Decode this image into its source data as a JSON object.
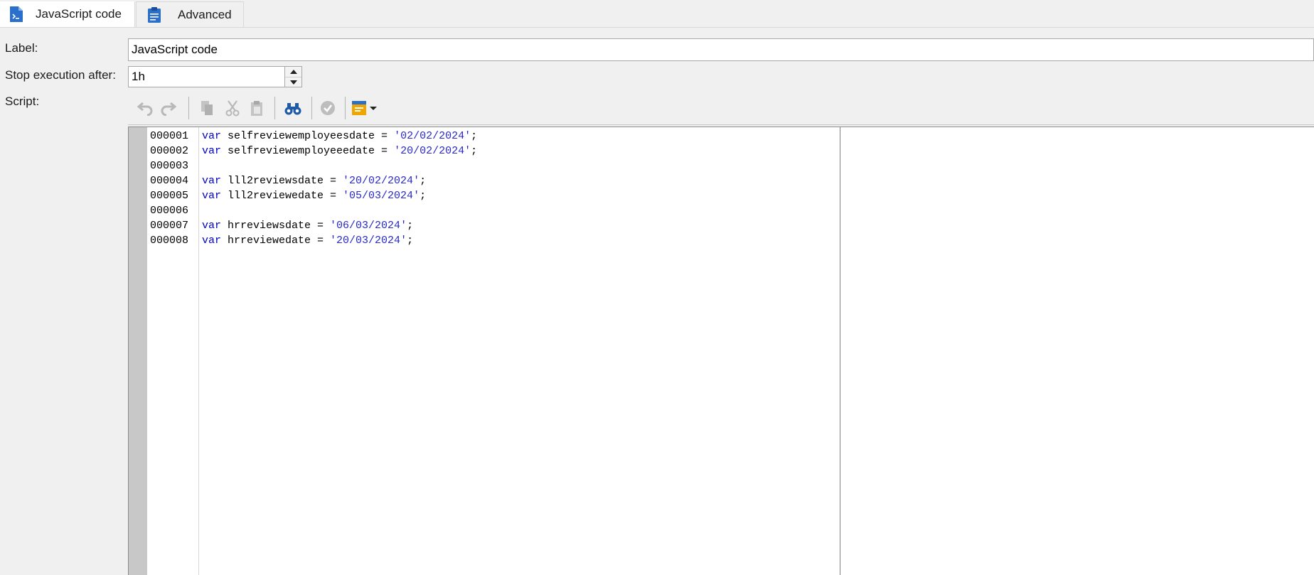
{
  "tabs": [
    {
      "label": "JavaScript code",
      "icon": "script-file-icon",
      "active": true
    },
    {
      "label": "Advanced",
      "icon": "clipboard-icon",
      "active": false
    }
  ],
  "form": {
    "label_caption": "Label:",
    "label_value": "JavaScript code",
    "stop_caption": "Stop execution after:",
    "stop_value": "1h",
    "script_caption": "Script:"
  },
  "toolbar": {
    "buttons": [
      "undo-icon",
      "redo-icon",
      "copy-icon",
      "cut-icon",
      "paste-icon",
      "find-binoculars-icon",
      "check-syntax-icon",
      "insert-field-dropdown-icon"
    ]
  },
  "editor": {
    "lines": [
      {
        "num": "000001",
        "kw": "var",
        "rest": " selfreviewemployeesdate = ",
        "str": "'02/02/2024'",
        "end": ";"
      },
      {
        "num": "000002",
        "kw": "var",
        "rest": " selfreviewemployeeedate = ",
        "str": "'20/02/2024'",
        "end": ";"
      },
      {
        "num": "000003",
        "kw": "",
        "rest": "",
        "str": "",
        "end": ""
      },
      {
        "num": "000004",
        "kw": "var",
        "rest": " lll2reviewsdate = ",
        "str": "'20/02/2024'",
        "end": ";"
      },
      {
        "num": "000005",
        "kw": "var",
        "rest": " lll2reviewedate = ",
        "str": "'05/03/2024'",
        "end": ";"
      },
      {
        "num": "000006",
        "kw": "",
        "rest": "",
        "str": "",
        "end": ""
      },
      {
        "num": "000007",
        "kw": "var",
        "rest": " hrreviewsdate = ",
        "str": "'06/03/2024'",
        "end": ";"
      },
      {
        "num": "000008",
        "kw": "var",
        "rest": " hrreviewedate = ",
        "str": "'20/03/2024'",
        "end": ";"
      }
    ]
  },
  "colors": {
    "keyword": "#0000c8",
    "string": "#2929c8",
    "accent": "#2a6fc9"
  }
}
